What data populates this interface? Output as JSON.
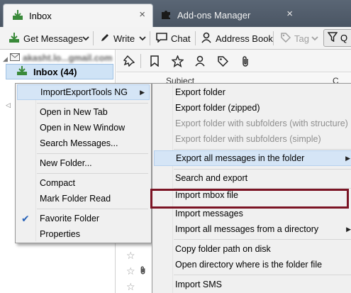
{
  "tabs": [
    {
      "label": "Inbox",
      "icon": "inbox-icon",
      "close": "×"
    },
    {
      "label": "Add-ons Manager",
      "icon": "puzzle-icon",
      "close": "×"
    }
  ],
  "toolbar": {
    "get_messages": "Get Messages",
    "write": "Write",
    "chat": "Chat",
    "address_book": "Address Book",
    "tag": "Tag",
    "quick_filter": "Q"
  },
  "folder_pane": {
    "account_name": "akasht.lo...gmail.com",
    "inbox_label": "Inbox (44)"
  },
  "message_list": {
    "col_subject": "Subject",
    "col_right": "C"
  },
  "context_menu": {
    "items": [
      {
        "label": "ImportExportTools NG",
        "submenu": true
      },
      {
        "label": "Open in New Tab"
      },
      {
        "label": "Open in New Window"
      },
      {
        "label": "Search Messages..."
      },
      {
        "label": "New Folder..."
      },
      {
        "label": "Compact"
      },
      {
        "label": "Mark Folder Read"
      },
      {
        "label": "Favorite Folder",
        "checked": true
      },
      {
        "label": "Properties"
      }
    ]
  },
  "submenu": {
    "items": [
      {
        "label": "Export folder",
        "disabled": false
      },
      {
        "label": "Export folder (zipped)",
        "disabled": false
      },
      {
        "label": "Export folder with subfolders (with structure)",
        "disabled": true
      },
      {
        "label": "Export folder with subfolders (simple)",
        "disabled": true
      },
      {
        "label": "Export all messages in the folder",
        "submenu": true
      },
      {
        "label": "Search and export"
      },
      {
        "label": "Import mbox file"
      },
      {
        "label": "Import messages"
      },
      {
        "label": "Import all messages from a directory",
        "submenu": true
      },
      {
        "label": "Copy folder path on disk"
      },
      {
        "label": "Open directory where is the folder file"
      },
      {
        "label": "Import SMS"
      }
    ]
  },
  "colors": {
    "highlight_border": "#7b1424",
    "selection_bg": "#cfe3f6",
    "menu_bg": "#f0f0f0"
  }
}
